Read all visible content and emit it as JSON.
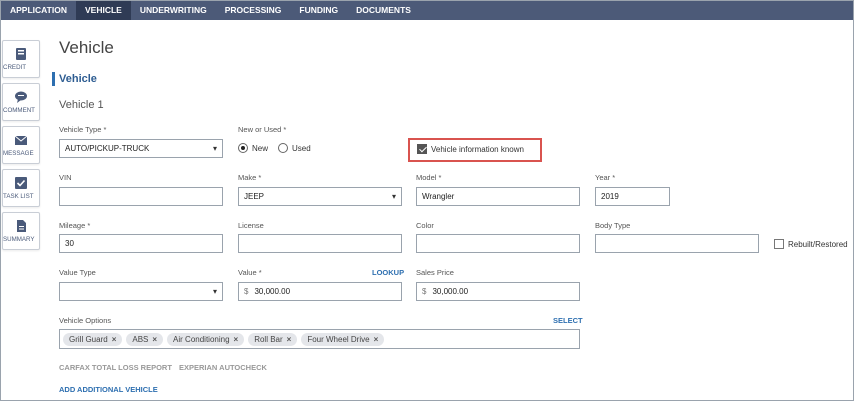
{
  "nav": {
    "tabs": [
      "APPLICATION",
      "VEHICLE",
      "UNDERWRITING",
      "PROCESSING",
      "FUNDING",
      "DOCUMENTS"
    ],
    "active": "VEHICLE"
  },
  "sidebar": {
    "items": [
      {
        "label": "CREDIT",
        "icon": "credit-card-icon"
      },
      {
        "label": "COMMENT",
        "icon": "comment-icon"
      },
      {
        "label": "MESSAGE",
        "icon": "envelope-icon"
      },
      {
        "label": "TASK LIST",
        "icon": "checkbox-icon"
      },
      {
        "label": "SUMMARY",
        "icon": "document-icon"
      }
    ]
  },
  "page": {
    "title": "Vehicle",
    "section": "Vehicle",
    "subtitle": "Vehicle 1"
  },
  "form": {
    "vehicle_type": {
      "label": "Vehicle Type *",
      "value": "AUTO/PICKUP-TRUCK"
    },
    "new_or_used": {
      "label": "New or Used *",
      "options": [
        "New",
        "Used"
      ],
      "selected": "New"
    },
    "vehicle_info_known": {
      "label": "Vehicle information known",
      "checked": true
    },
    "vin": {
      "label": "VIN",
      "value": ""
    },
    "make": {
      "label": "Make *",
      "value": "JEEP"
    },
    "model": {
      "label": "Model *",
      "value": "Wrangler"
    },
    "year": {
      "label": "Year *",
      "value": "2019"
    },
    "mileage": {
      "label": "Mileage *",
      "value": "30"
    },
    "license": {
      "label": "License",
      "value": ""
    },
    "color": {
      "label": "Color",
      "value": ""
    },
    "body_type": {
      "label": "Body Type",
      "value": ""
    },
    "rebuilt": {
      "label": "Rebuilt/Restored",
      "checked": false
    },
    "value_type": {
      "label": "Value Type",
      "value": ""
    },
    "value": {
      "label": "Value *",
      "prefix": "$",
      "value": "30,000.00",
      "lookup": "LOOKUP"
    },
    "sales_price": {
      "label": "Sales Price",
      "prefix": "$",
      "value": "30,000.00"
    },
    "vehicle_options": {
      "label": "Vehicle Options",
      "select": "SELECT",
      "chips": [
        "Grill Guard",
        "ABS",
        "Air Conditioning",
        "Roll Bar",
        "Four Wheel Drive"
      ]
    }
  },
  "actions": {
    "carfax": "CARFAX TOTAL LOSS REPORT",
    "experian": "EXPERIAN AUTOCHECK",
    "add_vehicle": "ADD ADDITIONAL VEHICLE"
  },
  "colors": {
    "nav_bg": "#4c5a78",
    "nav_active": "#2f3b55",
    "accent": "#2e6fb0",
    "highlight": "#d9534f"
  }
}
